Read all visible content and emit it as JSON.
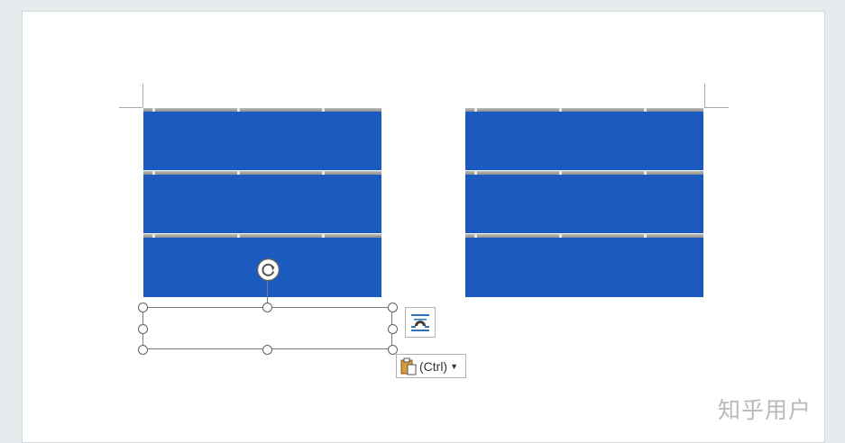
{
  "document": {
    "left_group": {
      "name": "left-bar-group",
      "bars": 3
    },
    "right_group": {
      "name": "right-bar-group",
      "bars": 3
    },
    "bar_color": "#1b5abf"
  },
  "selection": {
    "icons": {
      "rotate": "rotate-icon",
      "layout": "layout-options-icon",
      "paste": "clipboard-icon"
    }
  },
  "paste_options": {
    "label": "(Ctrl)",
    "dropdown": "chevron-down-icon"
  },
  "watermark": {
    "text": "知乎用户"
  }
}
